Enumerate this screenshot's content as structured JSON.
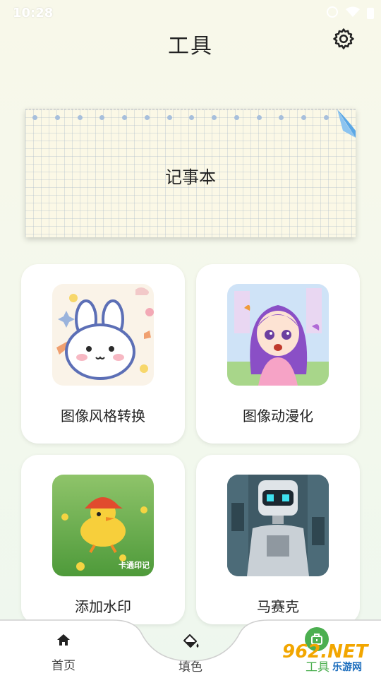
{
  "status_bar": {
    "time": "10:28"
  },
  "header": {
    "title": "工具"
  },
  "notepad": {
    "label": "记事本"
  },
  "cards": [
    {
      "label": "图像风格转换",
      "image": "bunny-illustration"
    },
    {
      "label": "图像动漫化",
      "image": "anime-girl-illustration"
    },
    {
      "label": "添加水印",
      "image": "duckling-photo",
      "image_caption": "卡通印记"
    },
    {
      "label": "马赛克",
      "image": "robot-illustration"
    }
  ],
  "bottom_nav": {
    "items": [
      {
        "label": "首页",
        "icon": "home-icon"
      },
      {
        "label": "填色",
        "icon": "paint-bucket-icon"
      },
      {
        "label": "工具",
        "icon": "toolbox-icon",
        "active": true
      }
    ]
  },
  "watermark": {
    "text": "962.NET",
    "sub": "乐游网"
  },
  "colors": {
    "accent": "#4caf50",
    "notepad_fold": "#5aa7e6",
    "background": "#f6f8ec"
  }
}
